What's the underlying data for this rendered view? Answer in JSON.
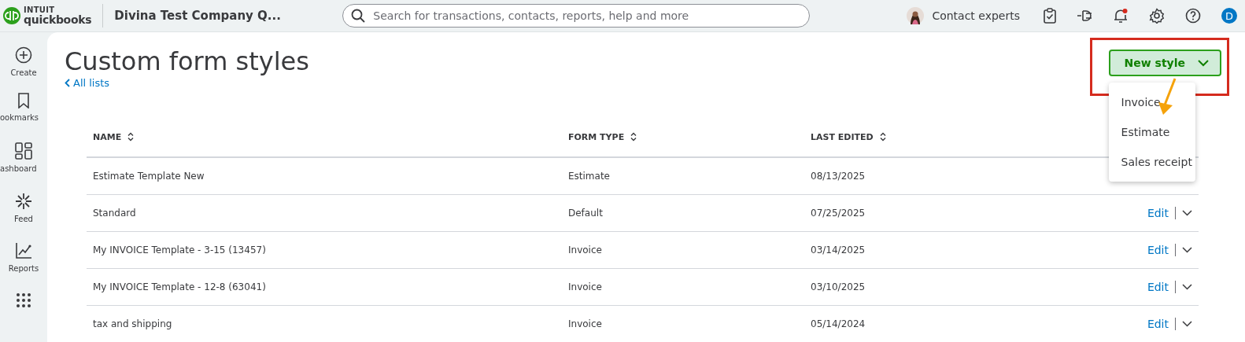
{
  "top_bar": {
    "brand_top": "INTUIT",
    "brand_name": "quickbooks",
    "company": "Divina Test Company Q...",
    "search": {
      "placeholder": "Search for transactions, contacts, reports, help and more"
    },
    "contact": "Contact experts",
    "notifications_alert": true,
    "avatar": "D"
  },
  "sidebar": {
    "items": [
      {
        "label": "Create"
      },
      {
        "label": "ookmarks"
      },
      {
        "label": "ashboard"
      },
      {
        "label": "Feed"
      },
      {
        "label": "Reports"
      }
    ]
  },
  "page": {
    "title": "Custom form styles",
    "back_link": "All lists",
    "new_button": "New style",
    "menu_open": true,
    "menu": [
      {
        "label": "Invoice"
      },
      {
        "label": "Estimate"
      },
      {
        "label": "Sales receipt"
      }
    ]
  },
  "table": {
    "columns": [
      "NAME",
      "FORM TYPE",
      "LAST EDITED"
    ],
    "rows": [
      {
        "name": "Estimate Template New",
        "form_type": "Estimate",
        "last_edited": "08/13/2025"
      },
      {
        "name": "Standard",
        "form_type": "Default",
        "last_edited": "07/25/2025",
        "action": "Edit"
      },
      {
        "name": "My INVOICE Template - 3-15 (13457)",
        "form_type": "Invoice",
        "last_edited": "03/14/2025",
        "action": "Edit"
      },
      {
        "name": "My INVOICE Template - 12-8 (63041)",
        "form_type": "Invoice",
        "last_edited": "03/10/2025",
        "action": "Edit"
      },
      {
        "name": "tax and shipping",
        "form_type": "Invoice",
        "last_edited": "05/14/2024",
        "action": "Edit"
      }
    ]
  }
}
